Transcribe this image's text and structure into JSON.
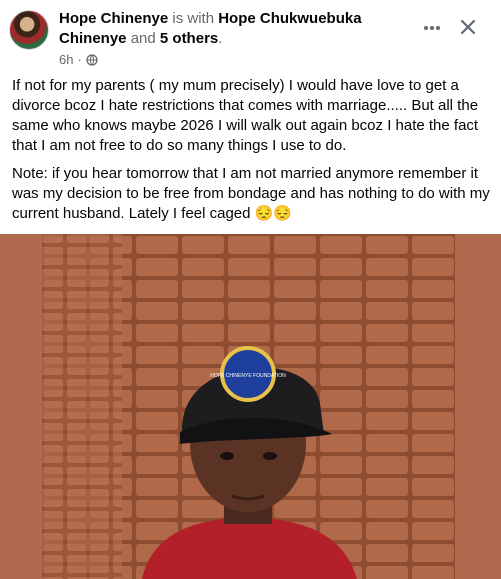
{
  "post": {
    "author": "Hope Chinenye",
    "with_text": "is with",
    "tagged_name": "Hope Chukwuebuka Chinenye",
    "and_text": "and",
    "others": "5 others",
    "period": ".",
    "time": "6h",
    "dot": "·",
    "privacy_icon": "globe-icon",
    "paragraphs": [
      "If not for my parents ( my mum precisely) I would have love to get a divorce bcoz I hate restrictions that comes with marriage..... But all the same who knows maybe 2026 I will walk out again bcoz I hate the fact that I am not free to do so many things I use to do.",
      "Note: if you hear tomorrow that I am not married anymore remember it was my decision to be free from bondage and has nothing to do with my current husband. Lately I feel caged 😔😔"
    ]
  },
  "controls": {
    "more_icon": "more-icon",
    "close_icon": "close-icon"
  },
  "photo": {
    "cap_logo_text": "HOPE CHINENYE FOUNDATION"
  },
  "colors": {
    "text": "#050505",
    "muted": "#65676b",
    "photo_bg": "#b06a4d",
    "brick": "#a0593a"
  }
}
